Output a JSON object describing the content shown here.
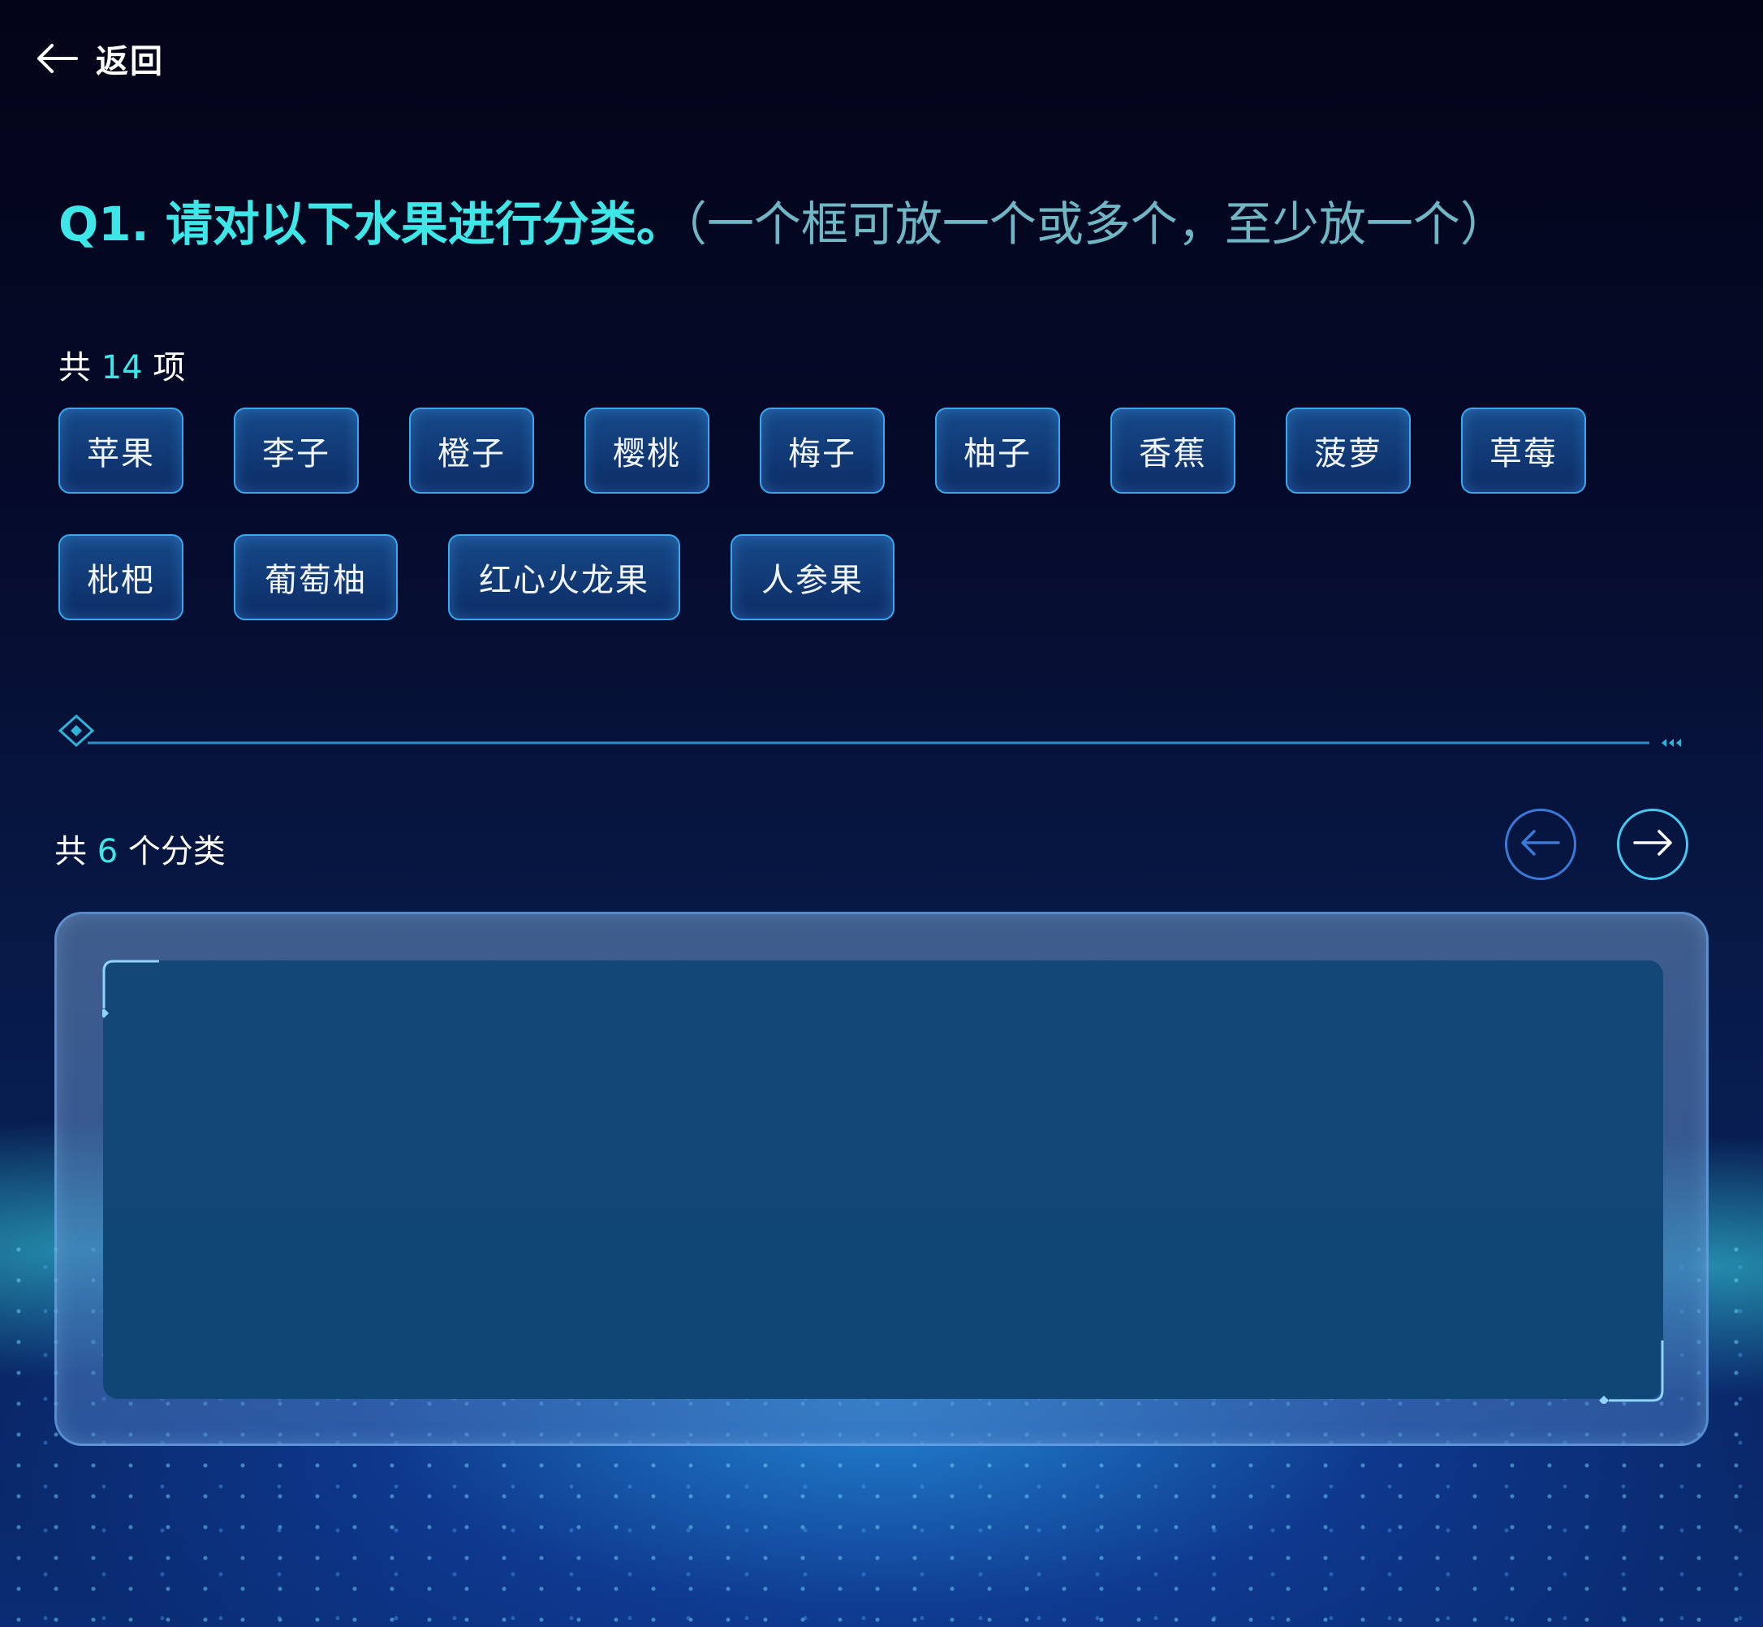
{
  "header": {
    "back_label": "返回"
  },
  "question": {
    "main": "Q1. 请对以下水果进行分类。",
    "hint": "（一个框可放一个或多个，至少放一个）"
  },
  "items_count": {
    "prefix": "共",
    "count": "14",
    "suffix": "项"
  },
  "items": [
    "苹果",
    "李子",
    "橙子",
    "樱桃",
    "梅子",
    "柚子",
    "香蕉",
    "菠萝",
    "草莓",
    "枇杷",
    "葡萄柚",
    "红心火龙果",
    "人参果"
  ],
  "categories_count": {
    "prefix": "共",
    "count": "6",
    "suffix": "个分类"
  },
  "colors": {
    "accent": "#3ee6e8",
    "chip_border": "#3aa8f0",
    "hint": "#6fb7c4"
  },
  "icons": {
    "back": "arrow-left-icon",
    "prev": "arrow-left-icon",
    "next": "arrow-right-icon"
  }
}
